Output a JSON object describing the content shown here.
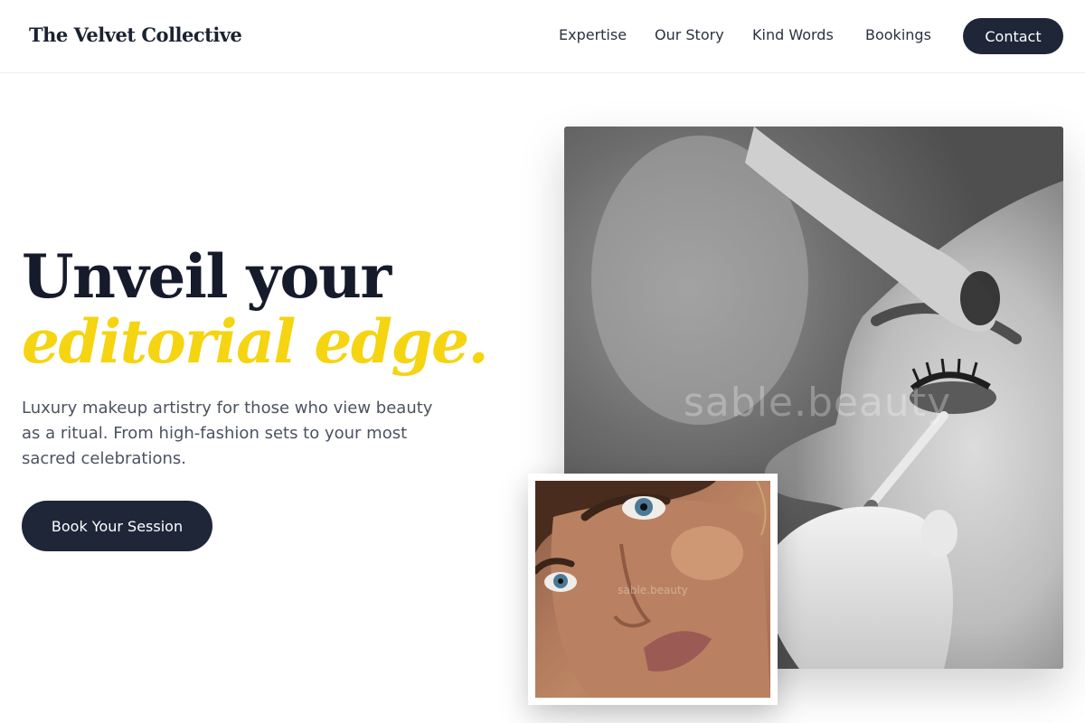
{
  "header": {
    "brand": "The Velvet Collective",
    "nav": [
      "Expertise",
      "Our Story",
      "Kind Words",
      "Bookings"
    ],
    "contact_label": "Contact"
  },
  "hero": {
    "headline_line1": "Unveil your",
    "headline_line2": "editorial edge.",
    "lede": "Luxury makeup artistry for those who view beauty as a ritual. From high-fashion sets to your most sacred celebrations.",
    "cta_label": "Book Your Session"
  },
  "images": {
    "main_watermark": "sable.beauty",
    "small_watermark": "sable.beauty"
  },
  "colors": {
    "navy": "#1e2638",
    "accent_yellow": "#f5d411",
    "body_text": "#4b5261"
  }
}
